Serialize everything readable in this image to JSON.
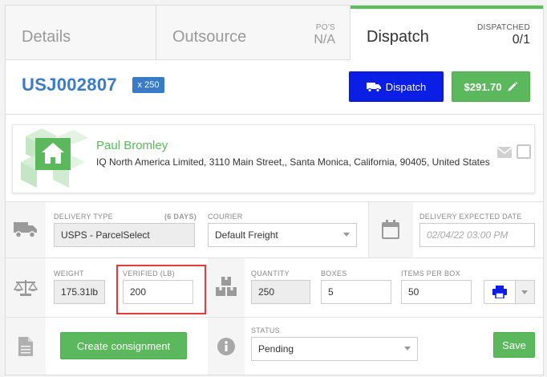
{
  "tabs": [
    {
      "label": "Details"
    },
    {
      "label": "Outsource",
      "sub_label": "PO'S",
      "sub_value": "N/A"
    },
    {
      "label": "Dispatch",
      "sub_label": "DISPATCHED",
      "sub_value": "0/1"
    }
  ],
  "header": {
    "order_id": "USJ002807",
    "qty_badge": "x 250",
    "dispatch_label": "Dispatch",
    "price_label": "$291.70"
  },
  "customer": {
    "name": "Paul Bromley",
    "address": "IQ North America Limited, 3110 Main Street,, Santa Monica, California, 90405, United States"
  },
  "delivery": {
    "type_label": "DELIVERY TYPE",
    "type_days": "(6 DAYS)",
    "type_value": "USPS - ParcelSelect",
    "courier_label": "COURIER",
    "courier_value": "Default Freight",
    "expected_label": "DELIVERY EXPECTED DATE",
    "expected_placeholder": "02/04/22 03:00 PM"
  },
  "weights": {
    "weight_label": "WEIGHT",
    "weight_value": "175.31lb",
    "verified_label": "VERIFIED (LB)",
    "verified_value": "200",
    "quantity_label": "QUANTITY",
    "quantity_value": "250",
    "boxes_label": "BOXES",
    "boxes_value": "5",
    "items_label": "ITEMS PER BOX",
    "items_value": "50"
  },
  "actions": {
    "create_label": "Create consignment",
    "status_label": "STATUS",
    "status_value": "Pending",
    "save_label": "Save"
  },
  "colors": {
    "accent_blue": "#3a7bc8",
    "dispatch_blue": "#0b1ee6",
    "green": "#5cb85c",
    "highlight_red": "#e23b3b"
  }
}
